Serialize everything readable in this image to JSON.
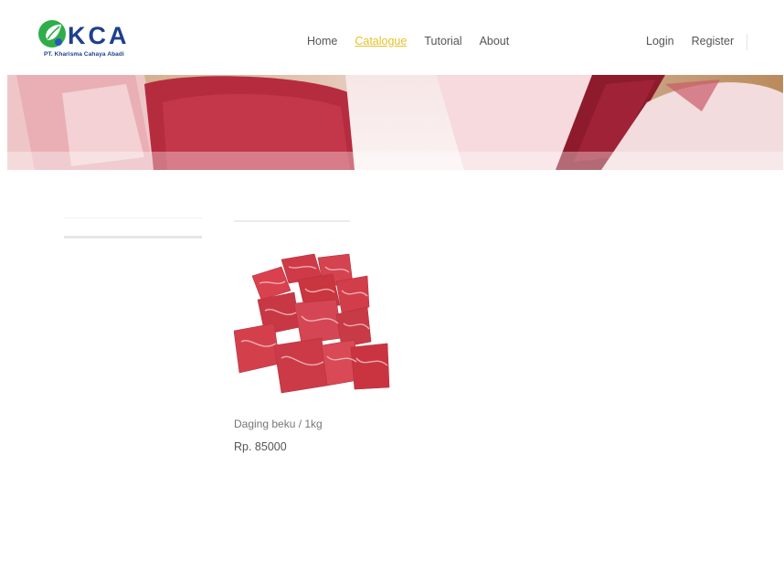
{
  "brand": {
    "logo_letters": "KCA",
    "logo_subtitle": "PT. Kharisma Cahaya Abadi"
  },
  "nav": {
    "items": [
      {
        "label": "Home",
        "active": false
      },
      {
        "label": "Catalogue",
        "active": true
      },
      {
        "label": "Tutorial",
        "active": false
      },
      {
        "label": "About",
        "active": false
      }
    ],
    "login_label": "Login",
    "register_label": "Register",
    "active_color": "#e4c227"
  },
  "banner": {
    "image": "frozen-meat-banner"
  },
  "products": [
    {
      "name": "Daging beku / 1kg",
      "price": "Rp. 85000",
      "image": "beef-cubes-image"
    }
  ]
}
